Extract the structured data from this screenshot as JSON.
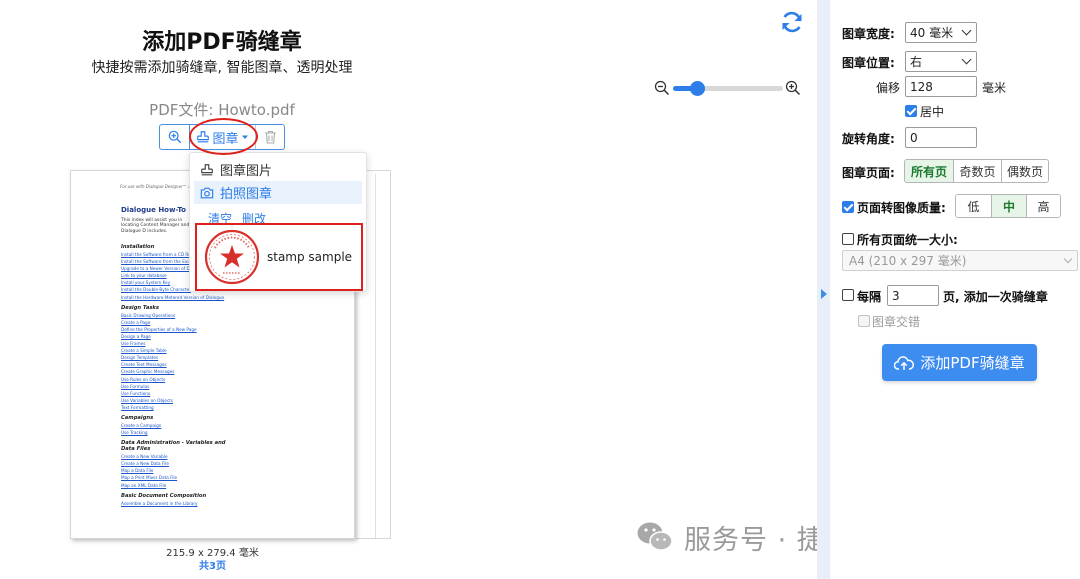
{
  "header": {
    "title": "添加PDF骑缝章",
    "subtitle": "快捷按需添加骑缝章, 智能图章、透明处理"
  },
  "file": {
    "label": "PDF文件: Howto.pdf"
  },
  "zoom": {
    "level": 0.22
  },
  "toolbar": {
    "stamp_label": "图章"
  },
  "stamp_menu": {
    "items": [
      {
        "label": "图章图片",
        "icon": "stamp-icon"
      },
      {
        "label": "拍照图章",
        "icon": "camera-icon"
      }
    ],
    "clear_label": "清空",
    "delete_label": "删改",
    "stamp_sample_label": "stamp sample"
  },
  "document": {
    "header_text": "For use with Dialogue Designer™ and Dialogue",
    "title": "Dialogue How-To Index",
    "intro": "This index will assist you in locating Content Manager and Dialogue D includes.",
    "sections": [
      {
        "heading": "Installation",
        "links": [
          "Install the Software from a CD Rom",
          "Install the Software from the Exist",
          "Upgrade to a Newer Version of Dia",
          "Link to your database",
          "Install your System Key",
          "Install the Double-Byte Character",
          "Install the Hardware-Metered Version of Dialogue"
        ]
      },
      {
        "heading": "Design Tasks",
        "links": [
          "Basic Drawing Operations",
          "Create a Page",
          "Define the Properties of a New Page",
          "Design a Page",
          "Use Frames",
          "Create a Simple Table",
          "Design Templates",
          "Create Text Messages",
          "Create Graphic Messages",
          "Use Rules on Objects",
          "Use Formulas",
          "Use Functions",
          "Use Variables on Objects",
          "Text Formatting"
        ]
      },
      {
        "heading": "Campaigns",
        "links": [
          "Create a Campaign",
          "Use Tracking"
        ]
      },
      {
        "heading": "Data Administration - Variables and Data Files",
        "links": [
          "Create a New Variable",
          "Create a New Data File",
          "Map a Data File",
          "Map a Print Mixer Data File",
          "Map an XML Data File"
        ]
      },
      {
        "heading": "Basic Document Composition",
        "links": [
          "Assemble a Document in the Library"
        ]
      }
    ],
    "page_size": "215.9 x 279.4 毫米",
    "page_count": "共3页"
  },
  "settings": {
    "width_label": "图章宽度:",
    "width_value": "40 毫米",
    "position_label": "图章位置:",
    "position_value": "右",
    "offset_label": "偏移",
    "offset_value": "128",
    "offset_unit": "毫米",
    "center_label": "居中",
    "center_checked": true,
    "rotation_label": "旋转角度:",
    "rotation_value": "0",
    "pages_label": "图章页面:",
    "pages_options": [
      "所有页",
      "奇数页",
      "偶数页"
    ],
    "pages_selected": "所有页",
    "quality_label": "页面转图像质量:",
    "quality_checked": true,
    "quality_options": [
      "低",
      "中",
      "高"
    ],
    "quality_selected": "中",
    "uniform_label": "所有页面统一大小:",
    "uniform_checked": false,
    "uniform_value": "A4 (210 x 297 毫米)",
    "every_label": "每隔",
    "every_value": "3",
    "every_suffix": "页, 添加一次骑缝章",
    "every_checked": false,
    "alternate_label": "图章交错",
    "submit_label": "添加PDF骑缝章"
  },
  "watermark": {
    "text": "服务号 · 捷呈PDF工具平台"
  },
  "colors": {
    "accent": "#2d7ee8",
    "highlight_red": "#e0201b",
    "button": "#3d8cf0"
  }
}
